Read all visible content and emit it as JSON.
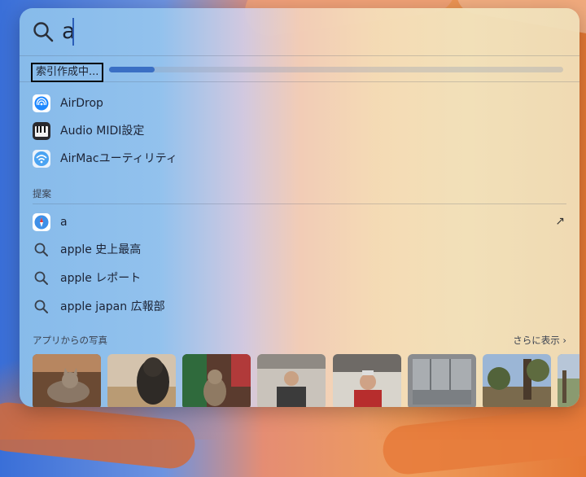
{
  "search": {
    "query": "a"
  },
  "indexing": {
    "label": "索引作成中...",
    "progress": 0.1
  },
  "apps": [
    {
      "label": "AirDrop",
      "icon": "airdrop-icon"
    },
    {
      "label": "Audio MIDI設定",
      "icon": "audio-midi-icon"
    },
    {
      "label": "AirMacユーティリティ",
      "icon": "airmac-utility-icon"
    }
  ],
  "suggestions_section": {
    "title": "提案"
  },
  "suggestions": [
    {
      "label": "a",
      "icon": "safari-icon"
    },
    {
      "label": "apple 史上最高",
      "icon": "search-icon"
    },
    {
      "label": "apple レポート",
      "icon": "search-icon"
    },
    {
      "label": "apple japan 広報部",
      "icon": "search-icon"
    }
  ],
  "photos_section": {
    "title": "アプリからの写真",
    "show_more": "さらに表示"
  },
  "colors": {
    "accent": "#3a6fc4",
    "text": "#1c2335"
  }
}
